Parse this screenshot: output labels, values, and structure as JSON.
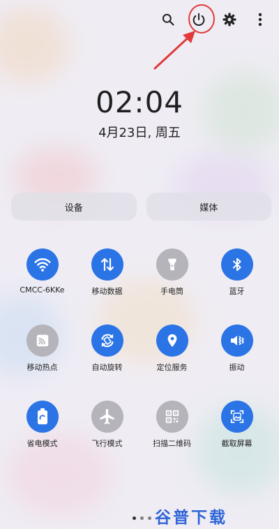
{
  "status": {
    "time": "02:04",
    "date": "4月23日, 周五"
  },
  "top_icons": [
    "search-icon",
    "power-icon",
    "gear-icon",
    "more-vert-icon"
  ],
  "tabs": {
    "devices": "设备",
    "media": "媒体"
  },
  "toggles": [
    {
      "label": "CMCC-6KKe",
      "icon": "wifi-icon",
      "on": true
    },
    {
      "label": "移动数据",
      "icon": "mobile-data-icon",
      "on": true
    },
    {
      "label": "手电筒",
      "icon": "flashlight-icon",
      "on": false
    },
    {
      "label": "蓝牙",
      "icon": "bluetooth-icon",
      "on": true
    },
    {
      "label": "移动热点",
      "icon": "hotspot-icon",
      "on": false
    },
    {
      "label": "自动旋转",
      "icon": "auto-rotate-icon",
      "on": true
    },
    {
      "label": "定位服务",
      "icon": "location-icon",
      "on": true
    },
    {
      "label": "振动",
      "icon": "vibrate-icon",
      "on": true
    },
    {
      "label": "省电模式",
      "icon": "battery-saver-icon",
      "on": true
    },
    {
      "label": "飞行模式",
      "icon": "airplane-icon",
      "on": false
    },
    {
      "label": "扫描二维码",
      "icon": "qr-scan-icon",
      "on": false
    },
    {
      "label": "截取屏幕",
      "icon": "screenshot-icon",
      "on": true
    }
  ],
  "watermark": "谷普下载",
  "colors": {
    "on": "#2b74e6",
    "off": "#b4b4ba",
    "annotation": "#e23a3a"
  }
}
